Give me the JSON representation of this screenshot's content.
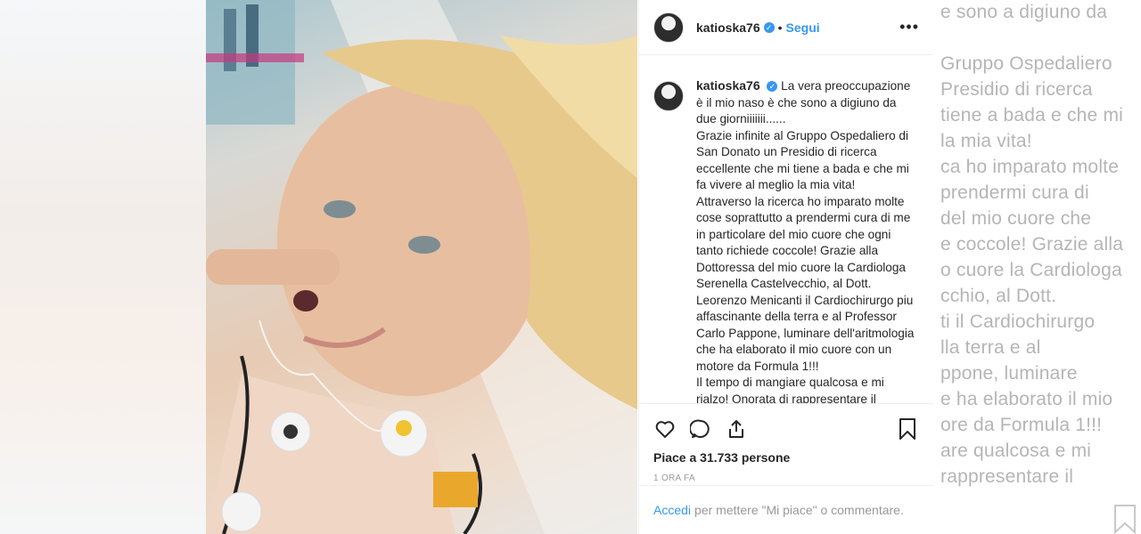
{
  "post": {
    "username": "katioska76",
    "follow_label": "Segui",
    "more_label": "•••",
    "dot": "•",
    "caption_lines": [
      "La vera preoccupazione è il mio naso è che sono a digiuno da due giorniiiiiii......",
      "Grazie infinite al Gruppo Ospedaliero di San Donato un Presidio di ricerca eccellente che mi tiene a bada e che mi fa vivere al meglio la mia vita!",
      "Attraverso la ricerca ho imparato molte cose soprattutto a prendermi cura di me in particolare del mio cuore che ogni tanto richiede coccole! Grazie alla Dottoressa del mio cuore la Cardiologa Serenella Castelvecchio, al Dott. Leorenzo Menicanti il Cardiochirurgo piu affascinante della terra e al Professor Carlo Pappone, luminare dell'aritmologia che ha elaborato il mio cuore con un motore da Formula 1!!!",
      "Il tempo di mangiare qualcosa e mi rialzo! Onorata di rappresentare il"
    ],
    "likes_text": "Piace a 31.733 persone",
    "timestamp": "1 ORA FA",
    "login_link": "Accedi",
    "login_text": "per mettere \"Mi piace\" o commentare."
  },
  "background_right_lines": [
    "e sono a digiuno da",
    "Gruppo Ospedaliero",
    "Presidio di ricerca",
    "tiene a bada e che mi",
    "la mia vita!",
    "ca ho imparato molte",
    "prendermi cura di",
    "del mio cuore che",
    "e coccole! Grazie alla",
    "o cuore la Cardiologa",
    "cchio, al Dott.",
    "ti il Cardiochirurgo",
    "lla terra e al",
    "ppone, luminare",
    "e ha elaborato il mio",
    "ore da Formula 1!!!",
    "are qualcosa e mi",
    "rappresentare il"
  ],
  "colors": {
    "accent": "#3897f0",
    "text": "#262626",
    "muted": "#999999",
    "border": "#efefef"
  }
}
